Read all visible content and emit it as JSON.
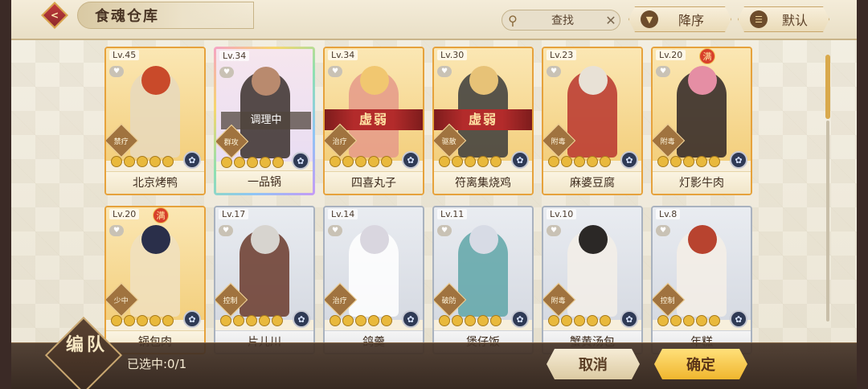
{
  "header": {
    "title": "食魂仓库",
    "search_label": "查找",
    "sort_label": "降序",
    "default_label": "默认"
  },
  "cards": [
    {
      "level": "Lv.45",
      "name": "北京烤鸭",
      "role": "禁疗",
      "stars": 5,
      "frame": "gold",
      "overlay": "",
      "full": false,
      "skin": "#c94a2a",
      "cloth": "#e8d9bd"
    },
    {
      "level": "Lv.34",
      "name": "一品锅",
      "role": "群攻",
      "stars": 5,
      "frame": "rainbow",
      "overlay": "调理中",
      "full": false,
      "skin": "#b98a6e",
      "cloth": "#3a2f2c"
    },
    {
      "level": "Lv.34",
      "name": "四喜丸子",
      "role": "治疗",
      "stars": 5,
      "frame": "gold",
      "overlay": "虚弱",
      "full": false,
      "skin": "#f1c770",
      "cloth": "#e59a8a"
    },
    {
      "level": "Lv.30",
      "name": "符离集烧鸡",
      "role": "驱散",
      "stars": 5,
      "frame": "gold",
      "overlay": "虚弱",
      "full": false,
      "skin": "#e7c277",
      "cloth": "#3b3b3b"
    },
    {
      "level": "Lv.23",
      "name": "麻婆豆腐",
      "role": "附毒",
      "stars": 5,
      "frame": "gold",
      "overlay": "",
      "full": false,
      "skin": "#e8e1d6",
      "cloth": "#b8352e"
    },
    {
      "level": "Lv.20",
      "name": "灯影牛肉",
      "role": "附毒",
      "stars": 5,
      "frame": "gold",
      "overlay": "",
      "full": true,
      "skin": "#e58ea4",
      "cloth": "#2e2424"
    },
    {
      "level": "Lv.20",
      "name": "锅包肉",
      "role": "少中",
      "stars": 5,
      "frame": "gold",
      "overlay": "",
      "full": true,
      "skin": "#2a2f4a",
      "cloth": "#f0e1c0"
    },
    {
      "level": "Lv.17",
      "name": "片儿川",
      "role": "控制",
      "stars": 5,
      "frame": "silver",
      "overlay": "",
      "full": false,
      "skin": "#d7d4cf",
      "cloth": "#6a3a2c"
    },
    {
      "level": "Lv.14",
      "name": "鸽羹",
      "role": "治疗",
      "stars": 5,
      "frame": "silver",
      "overlay": "",
      "full": false,
      "skin": "#d9d6df",
      "cloth": "#ffffff"
    },
    {
      "level": "Lv.11",
      "name": "煲仔饭",
      "role": "破防",
      "stars": 5,
      "frame": "silver",
      "overlay": "",
      "full": false,
      "skin": "#d7dbe5",
      "cloth": "#5fa6a8"
    },
    {
      "level": "Lv.10",
      "name": "蟹黄汤包",
      "role": "附毒",
      "stars": 5,
      "frame": "silver",
      "overlay": "",
      "full": false,
      "skin": "#2b2826",
      "cloth": "#f3efe8"
    },
    {
      "level": "Lv.8",
      "name": "年糕",
      "role": "控制",
      "stars": 5,
      "frame": "silver",
      "overlay": "",
      "full": false,
      "skin": "#b8432f",
      "cloth": "#f4efe6"
    }
  ],
  "bottom": {
    "formation_label": "编队",
    "selected_text": "已选中:0/1",
    "cancel_label": "取消",
    "confirm_label": "确定"
  },
  "full_badge_label": "满",
  "colors": {
    "gold_frame": "#e6a23c",
    "silver_frame": "#a9b2bf",
    "confirm": "#f0b62e",
    "ribbon": "#b32b2b"
  }
}
